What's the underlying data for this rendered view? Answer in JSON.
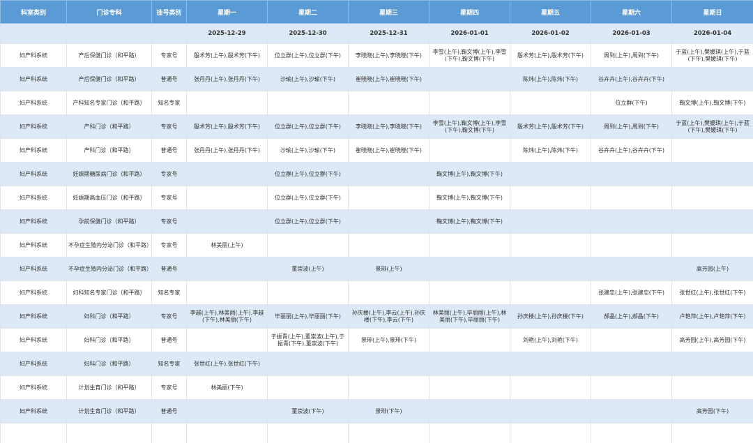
{
  "headers": {
    "dept": "科室类别",
    "clinic": "门诊专科",
    "reg": "挂号类别",
    "days": [
      "星期一",
      "星期二",
      "星期三",
      "星期四",
      "星期五",
      "星期六",
      "星期日"
    ]
  },
  "dates": [
    "2025-12-29",
    "2025-12-30",
    "2025-12-31",
    "2026-01-01",
    "2026-01-02",
    "2026-01-03",
    "2026-01-04"
  ],
  "rows": [
    {
      "dept": "妇产科系统",
      "clinic": "产后保健门诊（和平路）",
      "reg": "专家号",
      "d": [
        "殷术芳(上午),殷术芳(下午)",
        "位立群(上午),位立群(下午)",
        "李晓晓(上午),李晓晓(下午)",
        "李雪(上午),鞠文博(上午),李雪(下午),鞠文博(下午)",
        "殷术芳(上午),殷术芳(下午)",
        "周到(上午),周到(下午)",
        "于蓝(上午),樊媛琪(上午),于蓝(下午),樊媛琪(下午)"
      ]
    },
    {
      "dept": "妇产科系统",
      "clinic": "产后保健门诊（和平路）",
      "reg": "普通号",
      "d": [
        "张丹丹(上午),张丹丹(下午)",
        "沙瑜(上午),沙瑜(下午)",
        "崔晓晓(上午),崔晓晓(下午)",
        "",
        "陈炜(上午),陈炜(下午)",
        "谷卉卉(上午),谷卉卉(下午)",
        ""
      ]
    },
    {
      "dept": "妇产科系统",
      "clinic": "产科知名专家门诊（和平路）",
      "reg": "知名专家",
      "d": [
        "",
        "",
        "",
        "",
        "",
        "位立群(下午)",
        "鞠文博(上午),鞠文博(下午)"
      ]
    },
    {
      "dept": "妇产科系统",
      "clinic": "产科门诊（和平路）",
      "reg": "专家号",
      "d": [
        "殷术芳(上午),殷术芳(下午)",
        "位立群(上午),位立群(下午)",
        "李晓晓(上午),李晓晓(下午)",
        "李雪(上午),鞠文博(上午),李雪(下午),鞠文博(下午)",
        "殷术芳(上午),殷术芳(下午)",
        "周到(上午),周到(下午)",
        "于蓝(上午),樊媛琪(上午),于蓝(下午),樊媛琪(下午)"
      ]
    },
    {
      "dept": "妇产科系统",
      "clinic": "产科门诊（和平路）",
      "reg": "普通号",
      "d": [
        "张丹丹(上午),张丹丹(下午)",
        "沙瑜(上午),沙瑜(下午)",
        "崔晓晓(上午),崔晓晓(下午)",
        "",
        "陈炜(上午),陈炜(下午)",
        "谷卉卉(上午),谷卉卉(下午)",
        ""
      ]
    },
    {
      "dept": "妇产科系统",
      "clinic": "妊娠期糖尿病门诊（和平路）",
      "reg": "专家号",
      "d": [
        "",
        "位立群(上午),位立群(下午)",
        "",
        "鞠文博(上午),鞠文博(下午)",
        "",
        "",
        ""
      ]
    },
    {
      "dept": "妇产科系统",
      "clinic": "妊娠期高血压门诊（和平路）",
      "reg": "专家号",
      "d": [
        "",
        "位立群(上午),位立群(下午)",
        "",
        "鞠文博(上午),鞠文博(下午)",
        "",
        "",
        ""
      ]
    },
    {
      "dept": "妇产科系统",
      "clinic": "孕前保健门诊（和平路）",
      "reg": "专家号",
      "d": [
        "",
        "位立群(上午),位立群(下午)",
        "",
        "鞠文博(上午),鞠文博(下午)",
        "",
        "",
        ""
      ]
    },
    {
      "dept": "妇产科系统",
      "clinic": "不孕症生殖内分泌门诊（和平路）",
      "reg": "专家号",
      "d": [
        "林美丽(上午)",
        "",
        "",
        "",
        "",
        "",
        ""
      ]
    },
    {
      "dept": "妇产科系统",
      "clinic": "不孕症生殖内分泌门诊（和平路）",
      "reg": "普通号",
      "d": [
        "",
        "董崇波(上午)",
        "景琲(上午)",
        "",
        "",
        "",
        "高芳园(上午)"
      ]
    },
    {
      "dept": "妇产科系统",
      "clinic": "妇科知名专家门诊（和平路）",
      "reg": "知名专家",
      "d": [
        "",
        "",
        "",
        "",
        "",
        "张建忠(上午),张建忠(下午)",
        "张世红(上午),张世红(下午)"
      ]
    },
    {
      "dept": "妇产科系统",
      "clinic": "妇科门诊（和平路）",
      "reg": "专家号",
      "d": [
        "李越(上午),林美丽(上午),李越(下午),林美丽(下午)",
        "毕丽丽(上午),毕丽丽(下午)",
        "孙庆楼(上午),李云(上午),孙庆楼(下午),李云(下午)",
        "林美丽(上午),毕丽丽(上午),林美丽(下午),毕丽丽(下午)",
        "孙庆楼(上午),孙庆楼(下午)",
        "郝晶(上午),郝晶(下午)",
        "卢艳萍(上午),卢艳萍(下午)"
      ]
    },
    {
      "dept": "妇产科系统",
      "clinic": "妇科门诊（和平路）",
      "reg": "普通号",
      "d": [
        "",
        "于振青(上午),董崇波(上午),于振青(下午),董崇波(下午)",
        "景琲(上午),景琲(下午)",
        "",
        "刘艳(上午),刘艳(下午)",
        "",
        "高芳园(上午),高芳园(下午)"
      ]
    },
    {
      "dept": "妇产科系统",
      "clinic": "妇科门诊（和平路）",
      "reg": "知名专家",
      "d": [
        "张世红(上午),张世红(下午)",
        "",
        "",
        "",
        "",
        "",
        ""
      ]
    },
    {
      "dept": "妇产科系统",
      "clinic": "计划生育门诊（和平路）",
      "reg": "专家号",
      "d": [
        "林美丽(下午)",
        "",
        "",
        "",
        "",
        "",
        ""
      ]
    },
    {
      "dept": "妇产科系统",
      "clinic": "计划生育门诊（和平路）",
      "reg": "普通号",
      "d": [
        "",
        "董崇波(下午)",
        "景琲(下午)",
        "",
        "",
        "",
        "高芳园(下午)"
      ]
    }
  ]
}
